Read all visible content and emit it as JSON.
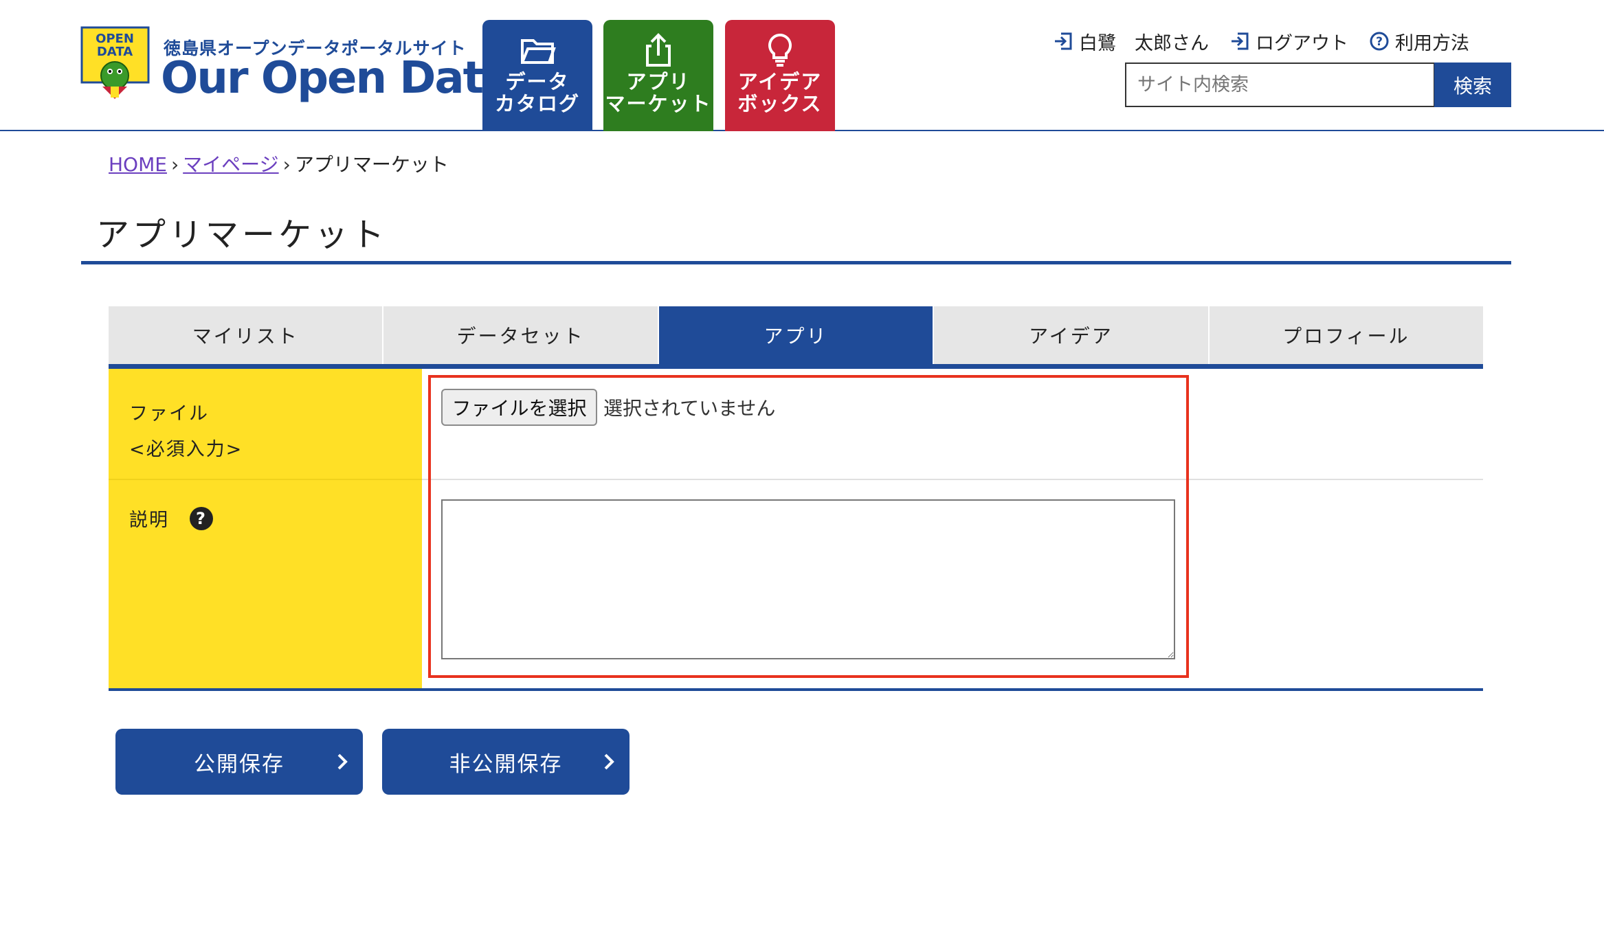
{
  "colors": {
    "primary": "#1f4b98",
    "green": "#2e7d1f",
    "red": "#c8263a",
    "yellow": "#ffe026",
    "highlight": "#e8321e"
  },
  "header": {
    "logo_text": "OPEN DATA",
    "site_subtitle": "徳島県オープンデータポータルサイト",
    "site_title": "Our Open Data",
    "nav": [
      {
        "label": "データ\nカタログ",
        "icon": "folder-icon"
      },
      {
        "label": "アプリ\nマーケット",
        "icon": "upload-icon"
      },
      {
        "label": "アイデア\nボックス",
        "icon": "lightbulb-icon"
      }
    ],
    "user_name": "白鷺　太郎さん",
    "logout_label": "ログアウト",
    "help_label": "利用方法",
    "search_placeholder": "サイト内検索",
    "search_button": "検索"
  },
  "breadcrumb": {
    "home": "HOME",
    "mypage": "マイページ",
    "current": "アプリマーケット",
    "separator": "›"
  },
  "page_title": "アプリマーケット",
  "tabs": [
    "マイリスト",
    "データセット",
    "アプリ",
    "アイデア",
    "プロフィール"
  ],
  "active_tab": "アプリ",
  "form": {
    "file_label": "ファイル",
    "file_required": "<必須入力>",
    "file_button": "ファイルを選択",
    "file_status": "選択されていません",
    "desc_label": "説明",
    "help_icon": "?",
    "desc_value": ""
  },
  "buttons": {
    "public_save": "公開保存",
    "private_save": "非公開保存"
  }
}
